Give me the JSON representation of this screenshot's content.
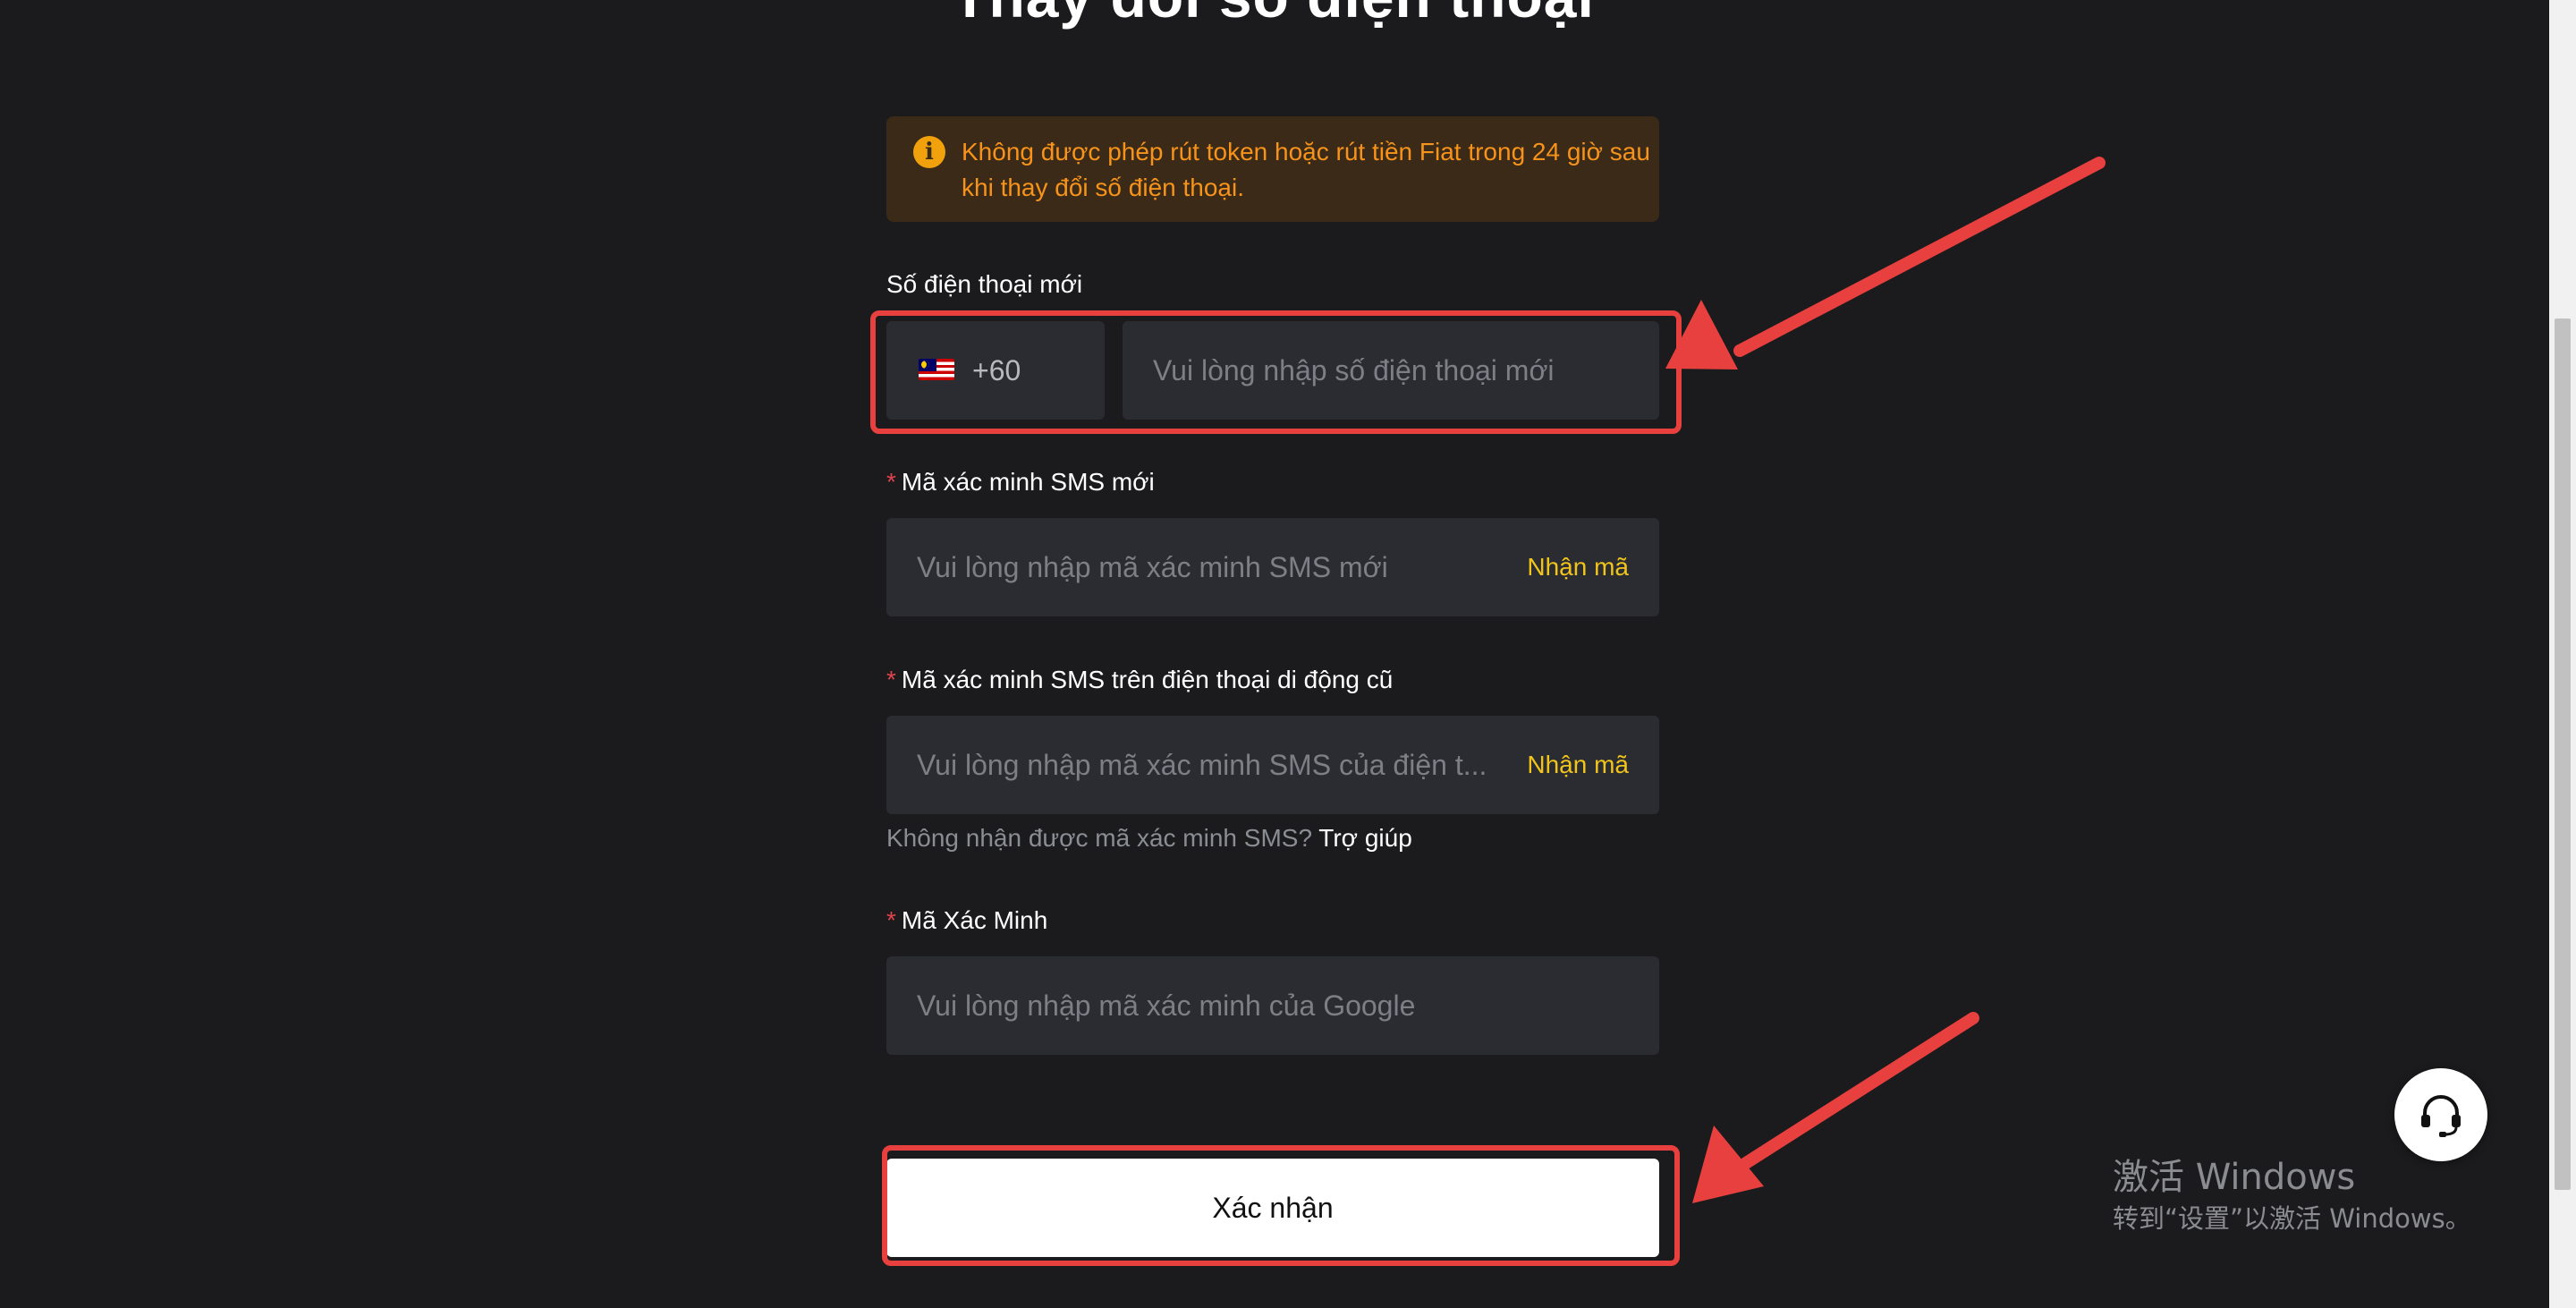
{
  "page": {
    "title": "Thay đổi số điện thoại"
  },
  "notice": {
    "icon": "info-icon",
    "text": "Không được phép rút token hoặc rút tiền Fiat trong 24 giờ sau khi thay đổi số điện thoại.",
    "color": "#f7931a"
  },
  "phone": {
    "label": "Số điện thoại mới",
    "country_flag": "malaysia-flag-icon",
    "dial_code": "+60",
    "placeholder": "Vui lòng nhập số điện thoại mới"
  },
  "new_sms": {
    "required_mark": "*",
    "label": "Mã xác minh SMS mới",
    "placeholder": "Vui lòng nhập mã xác minh SMS mới",
    "get_code": "Nhận mã"
  },
  "old_sms": {
    "required_mark": "*",
    "label": "Mã xác minh SMS trên điện thoại di động cũ",
    "placeholder": "Vui lòng nhập mã xác minh SMS của điện t...",
    "get_code": "Nhận mã",
    "help_text": "Không nhận được mã xác minh SMS?",
    "help_link": "Trợ giúp"
  },
  "google": {
    "required_mark": "*",
    "label": "Mã Xác Minh",
    "placeholder": "Vui lòng nhập mã xác minh của Google"
  },
  "submit": {
    "label": "Xác nhận"
  },
  "support": {
    "icon": "headset-icon"
  },
  "windows_activation": {
    "line1": "激活 Windows",
    "line2": "转到“设置”以激活 Windows。"
  },
  "colors": {
    "background": "#1b1b1d",
    "input_bg": "#2b2c31",
    "accent_yellow": "#f0c41b",
    "annotation_red": "#e8403f"
  }
}
